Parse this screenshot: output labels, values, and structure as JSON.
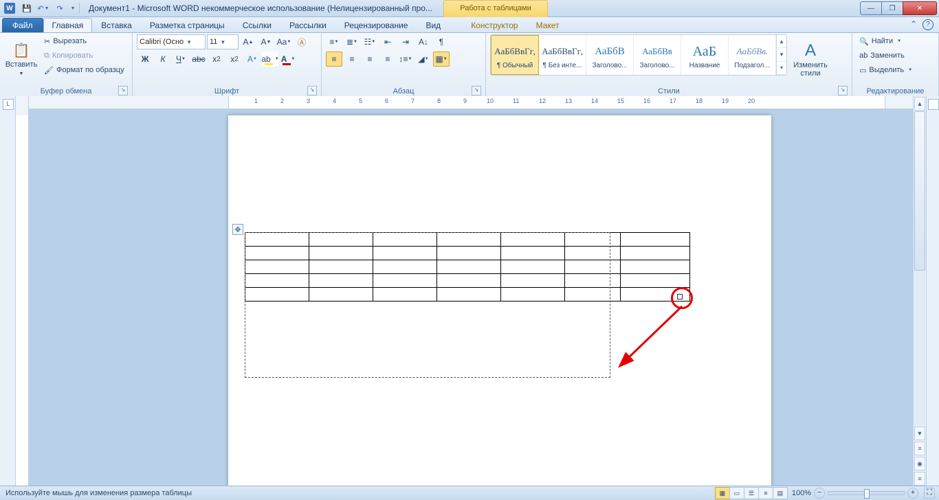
{
  "title_prefix": "Документ1 - Microsoft WORD некоммерческое использование (Нелицензированный про...",
  "contextual_tab_title": "Работа с таблицами",
  "qat": {
    "save": "💾",
    "undo": "↶",
    "redo": "↷"
  },
  "tabs": {
    "file": "Файл",
    "items": [
      "Главная",
      "Вставка",
      "Разметка страницы",
      "Ссылки",
      "Рассылки",
      "Рецензирование",
      "Вид"
    ],
    "context_items": [
      "Конструктор",
      "Макет"
    ],
    "active_index": 0
  },
  "ribbon": {
    "clipboard": {
      "label": "Буфер обмена",
      "paste": "Вставить",
      "cut": "Вырезать",
      "copy": "Копировать",
      "format": "Формат по образцу"
    },
    "font": {
      "label": "Шрифт",
      "name": "Calibri (Осно",
      "size": "11"
    },
    "paragraph": {
      "label": "Абзац"
    },
    "styles_group": {
      "label": "Стили",
      "change": "Изменить\nстили",
      "items": [
        {
          "prev": "АаБбВвГг,",
          "name": "¶ Обычный"
        },
        {
          "prev": "АаБбВвГг,",
          "name": "¶ Без инте..."
        },
        {
          "prev": "АаБбВ",
          "name": "Заголово..."
        },
        {
          "prev": "АаБбВв",
          "name": "Заголово..."
        },
        {
          "prev": "АаБ",
          "name": "Название"
        },
        {
          "prev": "АаБбВв.",
          "name": "Подзагол..."
        }
      ]
    },
    "editing": {
      "label": "Редактирование",
      "find": "Найти",
      "replace": "Заменить",
      "select": "Выделить"
    }
  },
  "leftbox": "L",
  "table": {
    "rows": 5,
    "cols": 7
  },
  "status": {
    "msg": "Используйте мышь для изменения размера таблицы",
    "zoom": "100%"
  }
}
